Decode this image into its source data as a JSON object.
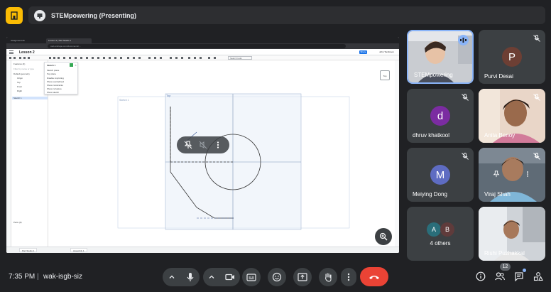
{
  "meeting": {
    "presentation_title": "STEMpowering (Presenting)",
    "time": "7:35 PM",
    "separator": "|",
    "code": "wak-isgb-siz",
    "participants_count": "12"
  },
  "screen": {
    "browser_tabs": [
      "Assignment #1",
      "Lesson 2 | Part Studio 1"
    ],
    "address": "cad.onshape.com/documents/...",
    "doc_title": "Lesson 2",
    "share_label": "Share",
    "user_label": "John Tomlinson",
    "search_tools": "Search tools",
    "feature_panel": {
      "header": "Features (4)",
      "filter": "Filter by name or type",
      "items": [
        "Default geometry",
        "Origin",
        "Top",
        "Front",
        "Right",
        "Sketch 1"
      ],
      "parts": "Parts (0)"
    },
    "sketch_dialog": {
      "title": "Sketch 1",
      "rows": [
        "Sketch plane",
        "Top plane",
        "Disable imprinting",
        "Show overdefined",
        "Show constraints",
        "Show curvature",
        "Show sketch"
      ]
    },
    "canvas": {
      "sketch_label": "Sketch 1",
      "plane_label": "Top"
    },
    "view_cube_label": "Top",
    "status_tabs": [
      "Part Studio 1",
      "Assembly 1"
    ]
  },
  "participants": [
    {
      "name": "STEMpowering",
      "speaking": true,
      "has_photo": true
    },
    {
      "name": "Purvi Desai",
      "initial": "P",
      "color": "#6d3f34",
      "muted": true
    },
    {
      "name": "dhruv khatkool",
      "initial": "d",
      "color": "#7b2ca1",
      "muted": true
    },
    {
      "name": "Anita Benoy",
      "muted": true,
      "has_photo": true
    },
    {
      "name": "Meiying Dong",
      "initial": "M",
      "color": "#5e6cc2",
      "muted": true
    },
    {
      "name": "Viraj Shah",
      "muted": true,
      "has_photo": true
    },
    {
      "others_label": "4 others",
      "avatars": [
        {
          "initial": "A",
          "color": "#2a6e7a"
        },
        {
          "initial": "B",
          "color": "#5f3b3b"
        }
      ]
    },
    {
      "name": "Rishi Puzhakkal",
      "has_photo": true
    }
  ],
  "colors": {
    "end_call": "#ea4335",
    "speaking_indicator": "#8ab4f8",
    "home_button": "#fbbc04"
  },
  "icons": [
    "home-icon",
    "presentation-icon",
    "mic-icon",
    "camera-icon",
    "captions-icon",
    "emoji-icon",
    "present-icon",
    "raise-hand-icon",
    "more-options-icon",
    "end-call-icon",
    "info-icon",
    "people-icon",
    "chat-icon",
    "activities-icon",
    "zoom-in-icon",
    "mic-off-icon",
    "speaking-icon"
  ]
}
